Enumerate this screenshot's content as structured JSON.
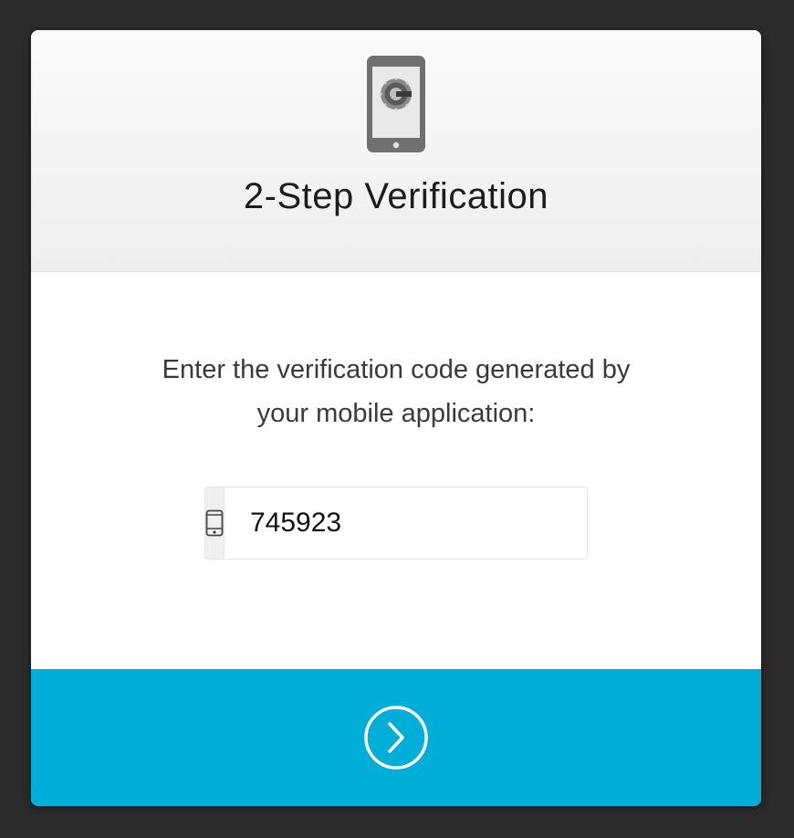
{
  "header": {
    "title": "2-Step Verification",
    "app_icon": "authenticator-phone-icon"
  },
  "body": {
    "instructions_line1": "Enter the verification code generated by",
    "instructions_line2": "your mobile application:"
  },
  "code_field": {
    "prefix_icon": "mobile-phone-icon",
    "value": "745923"
  },
  "footer": {
    "submit_icon": "circle-chevron-right-icon",
    "accent_color": "#00aed8"
  }
}
